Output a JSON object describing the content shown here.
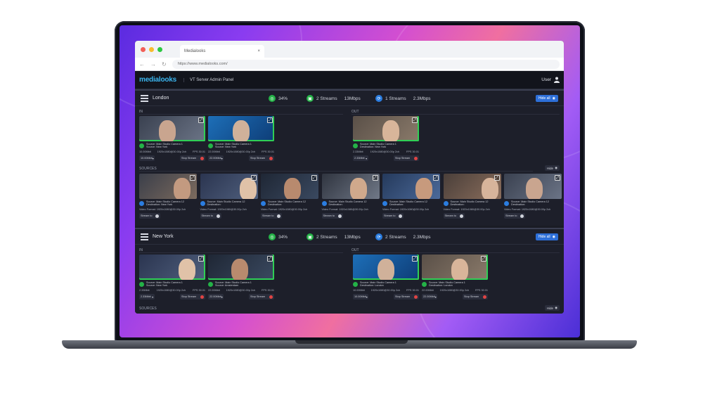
{
  "browser": {
    "tab_title": "Medialooks",
    "tab_close": "×",
    "url": "https://www.medialooks.com/",
    "back": "←",
    "forward": "→",
    "reload": "↻"
  },
  "app": {
    "logo": "medialooks",
    "title": "VT Server Admin Panel",
    "user": "User"
  },
  "colors": {
    "accent": "#3bb6f0",
    "live": "#2fcf55",
    "stop": "#e04444",
    "button_blue": "#2d6fd8"
  },
  "panels": [
    {
      "name": "London",
      "cpu": "34%",
      "in_streams": "2 Streams",
      "in_bitrate": "13Mbps",
      "out_streams": "1 Streams",
      "out_bitrate": "2.3Mbps",
      "hide_all": "Hide all",
      "in_label": "IN",
      "out_label": "OUT",
      "sources_label": "SOURCES",
      "hide": "Hide",
      "in_cards": [
        {
          "line1": "Source: Main Studio Camera 1",
          "line2": "Source: New York",
          "bitrate": "10.00Mbit",
          "format": "1920x1080@30.00p 2ch",
          "fps": "FPS 30.01",
          "sel": "10.00Mbit",
          "stop": "Stop Stream"
        },
        {
          "line1": "Source: Main Studio Camera 1",
          "line2": "Source: New York",
          "bitrate": "22.00Mbit",
          "format": "1920x1080@30.00p 2ch",
          "fps": "FPS 30.01",
          "sel": "22.00Mbit",
          "stop": "Stop Stream"
        }
      ],
      "out_cards": [
        {
          "line1": "Source: Main Studio Camera 1",
          "line2": "Destination: New York",
          "bitrate": "2.33Mbit",
          "format": "1920x1080@30.00p 2ch",
          "fps": "FPS 30.01",
          "sel": "2.33Mbit",
          "stop": "Stop Stream"
        }
      ],
      "source_cards": [
        {
          "line1": "Source: Main Studio Camera 12",
          "line2": "Destination: New York",
          "format": "Video Format: 1920x1080@30.00p 2ch",
          "btn": "Stream to"
        },
        {
          "line1": "Source: Main Studio Camera 12",
          "line2": "Destination:",
          "format": "Video Format: 1920x1080@30.00p 2ch",
          "btn": "Stream to"
        },
        {
          "line1": "Source: Main Studio Camera 12",
          "line2": "Destination:",
          "format": "Video Format: 1920x1080@30.00p 2ch",
          "btn": "Stream to"
        },
        {
          "line1": "Source: Main Studio Camera 12",
          "line2": "Destination:",
          "format": "Video Format: 1920x1080@30.00p 2ch",
          "btn": "Stream to"
        },
        {
          "line1": "Source: Main Studio Camera 12",
          "line2": "Destination:",
          "format": "Video Format: 1920x1080@30.00p 2ch",
          "btn": "Stream to"
        },
        {
          "line1": "Source: Main Studio Camera 12",
          "line2": "Destination:",
          "format": "Video Format: 1920x1080@30.00p 2ch",
          "btn": "Stream to"
        },
        {
          "line1": "Source: Main Studio Camera 12",
          "line2": "Destination:",
          "format": "Video Format: 1920x1080@30.00p 2ch",
          "btn": "Stream to"
        }
      ]
    },
    {
      "name": "New York",
      "cpu": "34%",
      "in_streams": "2 Streams",
      "in_bitrate": "13Mbps",
      "out_streams": "2 Streams",
      "out_bitrate": "2.3Mbps",
      "hide_all": "Hide all",
      "in_label": "IN",
      "out_label": "OUT",
      "sources_label": "SOURCES",
      "hide": "Hide",
      "in_cards": [
        {
          "line1": "Source: Main Studio Camera 1",
          "line2": "Source: New York",
          "bitrate": "2.33Mbit",
          "format": "1920x1080@30.00p 2ch",
          "fps": "FPS 30.01",
          "sel": "2.33Mbit",
          "stop": "Stop Stream"
        },
        {
          "line1": "Source: Main Studio Camera 1",
          "line2": "Source: Amsterdam",
          "bitrate": "22.00Mbit",
          "format": "1920x1080@30.00p 2ch",
          "fps": "FPS 30.01",
          "sel": "22.00Mbit",
          "stop": "Stop Stream"
        }
      ],
      "out_cards": [
        {
          "line1": "Source: Main Studio Camera 1",
          "line2": "Destination: London",
          "bitrate": "10.00Mbit",
          "format": "1920x1080@30.00p 2ch",
          "fps": "FPS 30.01",
          "sel": "10.00Mbit",
          "stop": "Stop Stream"
        },
        {
          "line1": "Source: Main Studio Camera 1",
          "line2": "Destination: London",
          "bitrate": "22.00Mbit",
          "format": "1920x1080@30.00p 2ch",
          "fps": "FPS 30.01",
          "sel": "22.00Mbit",
          "stop": "Stop Stream"
        }
      ]
    }
  ]
}
